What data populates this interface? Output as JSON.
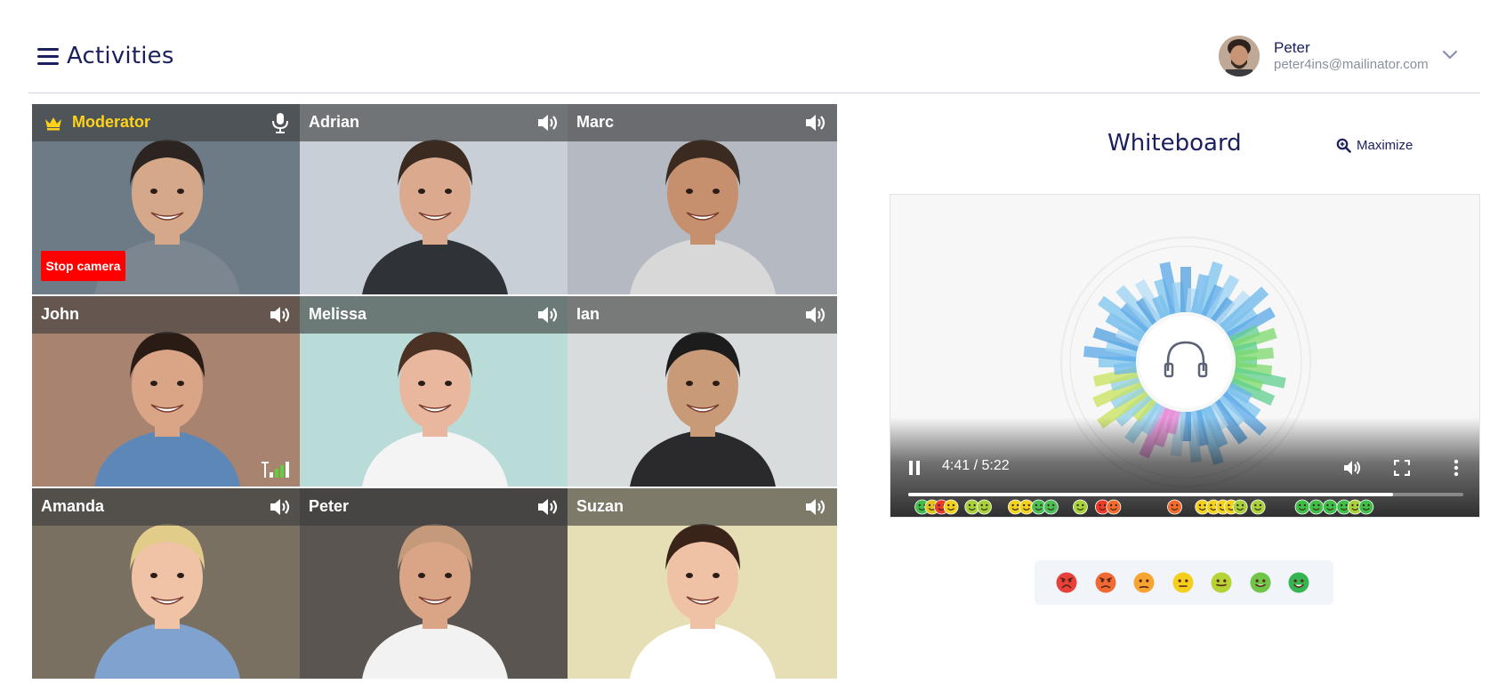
{
  "header": {
    "title": "Activities",
    "menu_icon": "hamburger-icon",
    "user": {
      "name": "Peter",
      "email": "peter4ins@mailinator.com",
      "dropdown_icon": "chevron-down-icon"
    }
  },
  "grid": {
    "participants": [
      {
        "name": "Moderator",
        "role": "moderator",
        "icon": "microphone-icon",
        "bg": "#6d7b86",
        "skin": "#d6a88a",
        "hair": "#2b2420",
        "shirt": "#7b8691",
        "stop_camera_label": "Stop camera"
      },
      {
        "name": "Adrian",
        "icon": "speaker-icon",
        "bg": "#c9cfd6",
        "skin": "#dba98d",
        "hair": "#3a2a20",
        "shirt": "#2f3338"
      },
      {
        "name": "Marc",
        "icon": "speaker-icon",
        "bg": "#b5bac2",
        "skin": "#c6906f",
        "hair": "#3b2a1f",
        "shirt": "#d8d8d8"
      },
      {
        "name": "John",
        "icon": "speaker-icon",
        "bg": "#a88470",
        "skin": "#d9a586",
        "hair": "#2a1b14",
        "shirt": "#5d87b6",
        "signal_icon": "signal-strength-icon"
      },
      {
        "name": "Melissa",
        "icon": "speaker-icon",
        "bg": "#b9dcd8",
        "skin": "#e8b79d",
        "hair": "#4a3124",
        "shirt": "#f4f4f4"
      },
      {
        "name": "Ian",
        "icon": "speaker-icon",
        "bg": "#d9dcdd",
        "skin": "#c99a78",
        "hair": "#1c1c1c",
        "shirt": "#2a2a2d"
      },
      {
        "name": "Amanda",
        "icon": "speaker-icon",
        "bg": "#7a7062",
        "skin": "#f0c2a6",
        "hair": "#e2cc8a",
        "shirt": "#7fa2cf"
      },
      {
        "name": "Peter",
        "icon": "speaker-icon",
        "bg": "#5b5552",
        "skin": "#d9a586",
        "hair": "#c49a7a",
        "shirt": "#f2f2f2"
      },
      {
        "name": "Suzan",
        "icon": "speaker-icon",
        "bg": "#e6dfb5",
        "skin": "#efc2a6",
        "hair": "#3a2318",
        "shirt": "#ffffff"
      }
    ]
  },
  "whiteboard": {
    "title": "Whiteboard",
    "maximize_label": "Maximize",
    "maximize_icon": "zoom-in-icon",
    "player": {
      "time": "4:41 / 5:22",
      "progress": 0.874,
      "center_icon": "headphones-icon",
      "pause_icon": "pause-icon",
      "volume_icon": "volume-icon",
      "fullscreen_icon": "fullscreen-icon",
      "more_icon": "more-vertical-icon",
      "emotion_markers": [
        {
          "pos": 0.025,
          "c": "#3fbf4a"
        },
        {
          "pos": 0.043,
          "c": "#e0c51b"
        },
        {
          "pos": 0.06,
          "c": "#ef3a2a"
        },
        {
          "pos": 0.077,
          "c": "#f2d21d"
        },
        {
          "pos": 0.115,
          "c": "#a9d23a"
        },
        {
          "pos": 0.137,
          "c": "#a9d23a"
        },
        {
          "pos": 0.193,
          "c": "#f2d21d"
        },
        {
          "pos": 0.213,
          "c": "#f2d21d"
        },
        {
          "pos": 0.235,
          "c": "#4bbf55"
        },
        {
          "pos": 0.257,
          "c": "#4bbf55"
        },
        {
          "pos": 0.31,
          "c": "#a9d23a"
        },
        {
          "pos": 0.35,
          "c": "#ef3a2a"
        },
        {
          "pos": 0.37,
          "c": "#f36b2d"
        },
        {
          "pos": 0.48,
          "c": "#f36b2d"
        },
        {
          "pos": 0.53,
          "c": "#f2d21d"
        },
        {
          "pos": 0.55,
          "c": "#f2d21d"
        },
        {
          "pos": 0.567,
          "c": "#f2d21d"
        },
        {
          "pos": 0.582,
          "c": "#f2d21d"
        },
        {
          "pos": 0.598,
          "c": "#a9d23a"
        },
        {
          "pos": 0.63,
          "c": "#a9d23a"
        },
        {
          "pos": 0.71,
          "c": "#3fbf4a"
        },
        {
          "pos": 0.735,
          "c": "#3fbf4a"
        },
        {
          "pos": 0.76,
          "c": "#3fbf4a"
        },
        {
          "pos": 0.785,
          "c": "#3fbf4a"
        },
        {
          "pos": 0.805,
          "c": "#a9d23a"
        },
        {
          "pos": 0.825,
          "c": "#3fbf4a"
        }
      ]
    },
    "feedback_faces": [
      {
        "name": "very-angry-face-icon",
        "c": "#e8413b",
        "mood": -3
      },
      {
        "name": "angry-face-icon",
        "c": "#f06a35",
        "mood": -2
      },
      {
        "name": "sad-face-icon",
        "c": "#f7a532",
        "mood": -1
      },
      {
        "name": "neutral-face-icon",
        "c": "#f5cf1d",
        "mood": 0
      },
      {
        "name": "slight-smile-face-icon",
        "c": "#b4d336",
        "mood": 1
      },
      {
        "name": "smile-face-icon",
        "c": "#6ec547",
        "mood": 2
      },
      {
        "name": "grin-face-icon",
        "c": "#37b452",
        "mood": 3
      }
    ]
  }
}
